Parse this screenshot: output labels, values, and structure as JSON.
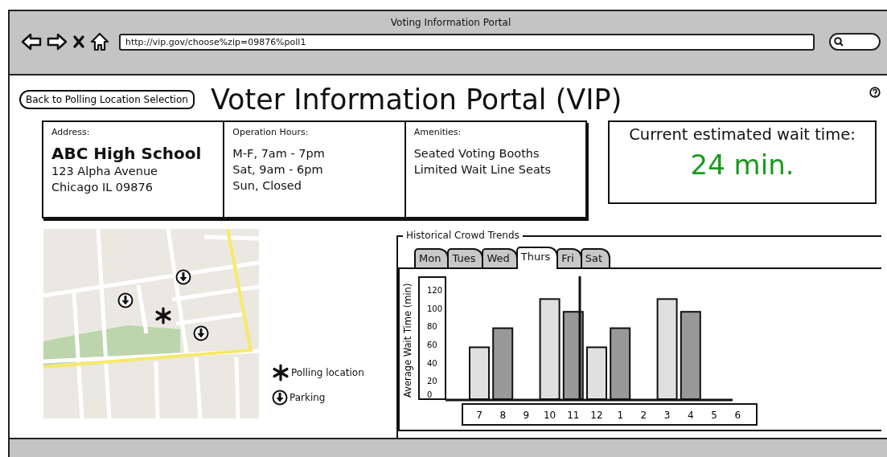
{
  "window": {
    "title": "Voting Information Portal"
  },
  "browser": {
    "url": "http://vip.gov/choose%zip=09876%poll1"
  },
  "back_button": "Back to Polling Location Selection",
  "page_title": "Voter Information Portal (VIP)",
  "info": [
    {
      "label": "Address:",
      "heading": "ABC High School",
      "lines": [
        "123 Alpha Avenue",
        "Chicago IL 09876"
      ]
    },
    {
      "label": "Operation Hours:",
      "lines": [
        "M-F, 7am - 7pm",
        "Sat, 9am - 6pm",
        "Sun, Closed"
      ]
    },
    {
      "label": "Amenities:",
      "lines": [
        "Seated Voting Booths",
        "Limited Wait Line Seats"
      ]
    }
  ],
  "wait_time": {
    "label": "Current estimated wait time:",
    "value": "24 min."
  },
  "legend": [
    {
      "kind": "polling",
      "label": "Polling location"
    },
    {
      "kind": "parking",
      "label": "Parking"
    }
  ],
  "trends": {
    "title": "Historical Crowd Trends",
    "tabs": [
      {
        "label": "Mon",
        "selected": false
      },
      {
        "label": "Tues",
        "selected": false
      },
      {
        "label": "Wed",
        "selected": false
      },
      {
        "label": "Thurs",
        "selected": true
      },
      {
        "label": "Fri",
        "selected": false
      },
      {
        "label": "Sat",
        "selected": false
      }
    ],
    "chart_data": {
      "type": "bar",
      "ylabel": "Average Wait Time (min)",
      "categories": [
        "7",
        "8",
        "9",
        "10",
        "11",
        "12",
        "1",
        "2",
        "3",
        "4",
        "5",
        "6"
      ],
      "series": [
        {
          "color": "#e0e0e0",
          "values": [
            57,
            null,
            null,
            110,
            null,
            57,
            null,
            null,
            110,
            null,
            null,
            null
          ]
        },
        {
          "color": "#999999",
          "values": [
            null,
            78,
            null,
            null,
            96,
            null,
            78,
            null,
            null,
            96,
            null,
            null
          ]
        }
      ],
      "ylim": [
        0,
        120
      ],
      "yticks": [
        0,
        20,
        40,
        60,
        80,
        100,
        120
      ]
    }
  }
}
